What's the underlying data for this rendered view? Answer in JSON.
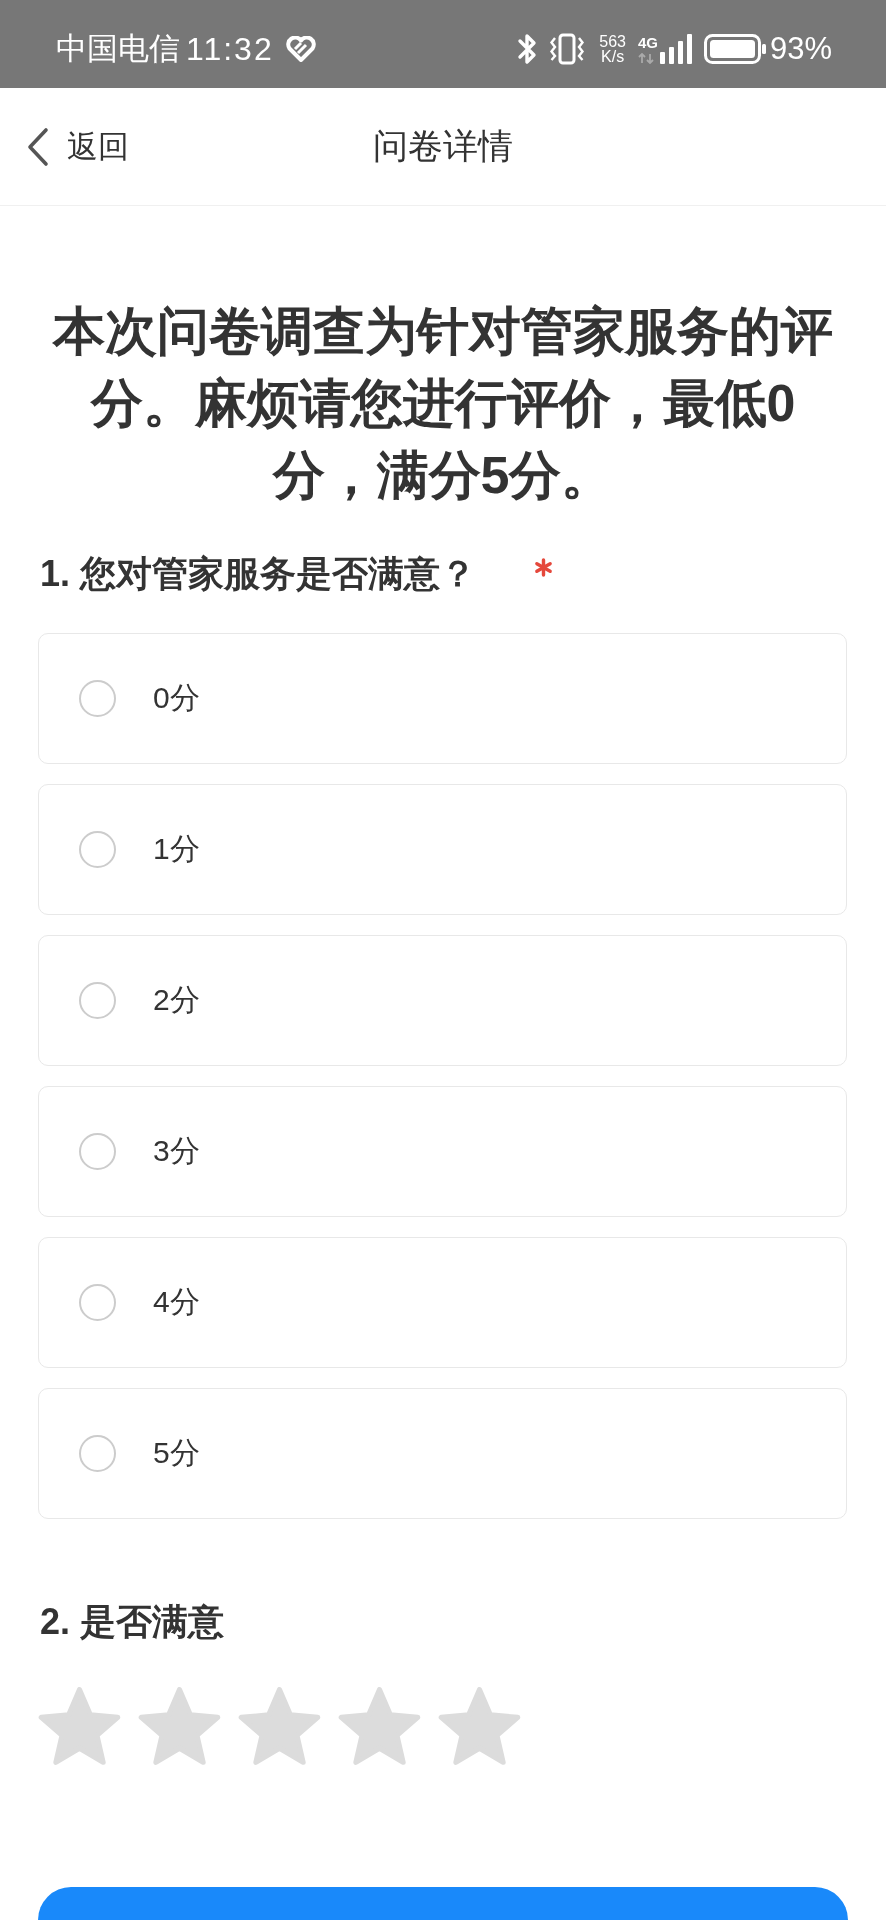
{
  "status_bar": {
    "carrier": "中国电信",
    "time": "11:32",
    "speed_value": "563",
    "speed_unit": "K/s",
    "network_type": "4G",
    "battery": "93%"
  },
  "header": {
    "back": "返回",
    "title": "问卷详情"
  },
  "intro": "本次问卷调查为针对管家服务的评分。麻烦请您进行评价，最低0分，满分5分。",
  "questions": [
    {
      "kind": "choice",
      "title": "1. 您对管家服务是否满意？",
      "required": true,
      "options": [
        {
          "label": "0分",
          "selected": false
        },
        {
          "label": "1分",
          "selected": false
        },
        {
          "label": "2分",
          "selected": false
        },
        {
          "label": "3分",
          "selected": false
        },
        {
          "label": "4分",
          "selected": false
        },
        {
          "label": "5分",
          "selected": false
        }
      ]
    },
    {
      "kind": "rating",
      "title": "2. 是否满意",
      "required": false,
      "stars": 0
    }
  ]
}
